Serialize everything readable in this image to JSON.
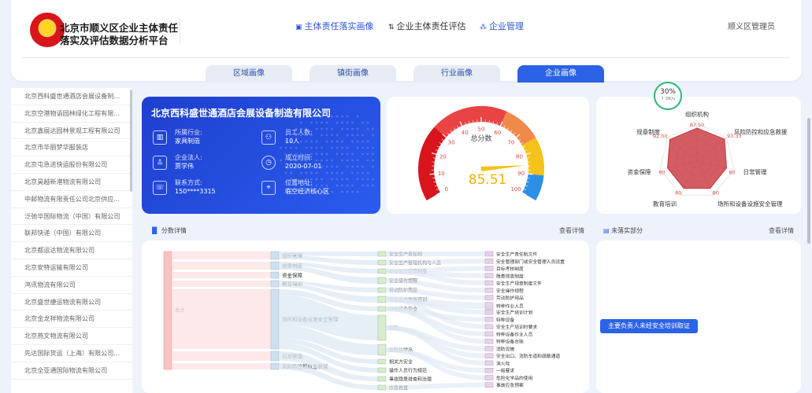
{
  "header": {
    "title": "北京市顺义区企业主体责任落实及评估数据分析平台",
    "nav": [
      {
        "label": "主体责任落实画像",
        "icon": "id-card-icon",
        "active": true
      },
      {
        "label": "企业主体责任评估",
        "icon": "sort-icon",
        "active": false
      },
      {
        "label": "企业管理",
        "icon": "org-tree-icon",
        "active": true
      }
    ],
    "user": "顺义区管理员"
  },
  "tabs": [
    {
      "label": "区域画像",
      "active": false
    },
    {
      "label": "镇街画像",
      "active": false
    },
    {
      "label": "行业画像",
      "active": false
    },
    {
      "label": "企业画像",
      "active": true
    }
  ],
  "companies": [
    "北京西科盛世通酒店会展设备制...",
    "北京空港物语园林绿化工程有限...",
    "北京鑫展达园林景观工程有限公司",
    "北京市华丽梦华服装店",
    "北京屯急送快运股份有限公司",
    "北京昊越新港物流有限公司",
    "中邮物流有限责任公司北京供应...",
    "泛弛华国际物流（中国）有限公司",
    "联邦快递（中国）有限公司",
    "北京都运达物流有限公司",
    "北京安特运输有限公司",
    "鸿讯物流有限公司",
    "北京盛世捷运物流有限公司",
    "北京金龙祥物流有限公司",
    "北京燕文物流有限公司",
    "先达国际货运（上海）有限公司...",
    "北京全亚通国际物流有限公司"
  ],
  "company": {
    "name": "北京西科盛世通酒店会展设备制造有限公司",
    "fields": [
      {
        "label": "所属行业:",
        "value": "家具制造",
        "icon": "building-icon"
      },
      {
        "label": "员工人数:",
        "value": "10人",
        "icon": "people-icon"
      },
      {
        "label": "企业法人:",
        "value": "贾学伟",
        "icon": "person-icon"
      },
      {
        "label": "成立时间:",
        "value": "2020-07-01",
        "icon": "clock-icon"
      },
      {
        "label": "联系方式:",
        "value": "150****3315",
        "icon": "phone-icon"
      },
      {
        "label": "位置地址:",
        "value": "临空经济核心区",
        "icon": "location-icon"
      }
    ]
  },
  "gauge": {
    "label": "总分数",
    "value": "85.51",
    "score": 85.51,
    "ticks": [
      "0",
      "10",
      "20",
      "30",
      "40",
      "50",
      "60",
      "70",
      "80",
      "90",
      "100"
    ]
  },
  "radar": {
    "badge": {
      "value": "30%",
      "sub": "↑ 0K/s"
    },
    "axes": [
      "组织机构",
      "风险防控和应急救援",
      "日常管理",
      "场所和设备设施安全管理",
      "教育培训",
      "资金保障",
      "规章制度"
    ],
    "values": [
      87.5,
      93.33,
      80,
      80,
      80,
      80,
      92
    ],
    "labels": [
      "87.50",
      "93.33",
      "80",
      "80",
      "80",
      "80",
      "92.00"
    ],
    "color": "#c8343c"
  },
  "score_detail": {
    "title": "分数详情",
    "more": "查看详情"
  },
  "untrained": {
    "title": "未落实部分",
    "more": "查看详情",
    "chip": "主要负责人未经安全培训取证"
  },
  "sankey": {
    "root": "合计",
    "level1": [
      "组织管理",
      "规章制度",
      "资金保障",
      "教育培训",
      "场所和设备设施安全管理",
      "日常管理",
      "风险防控和应急救援"
    ],
    "level2": [
      "安全生产责任制",
      "安全生产管理机构与人员",
      "安全生产规章制度",
      "安全操作规程",
      "劳动防护用品",
      "安全生产教育培训",
      "特种设备安全",
      "消防",
      "危险化学品",
      "相关方安全",
      "操作人员行为规范",
      "事故隐患排查和治理",
      "应急救援"
    ],
    "level3": [
      "安全生产责任制文件",
      "安全管理部门或安全管理人员设置",
      "目标考核制度",
      "隐患排查制度",
      "安全生产规章制度文件",
      "安全操作规程",
      "劳动防护用品",
      "特种作业人员",
      "安全生产培训计划",
      "特种设备",
      "安全生产培训时要求",
      "特种设备作业人员",
      "特种设备台账",
      "消防设施",
      "安全出口、消防车道和疏散通道",
      "消火栓",
      "一般要求",
      "危险化学品的使用",
      "事故应急预案"
    ],
    "colors": {
      "root": "#f7c4c4",
      "l1": "#cfe0f3",
      "l2": "#d8edce",
      "l3": "#e5d3e8",
      "link": "#dde8f3",
      "rootlink": "#fde3e3"
    }
  }
}
